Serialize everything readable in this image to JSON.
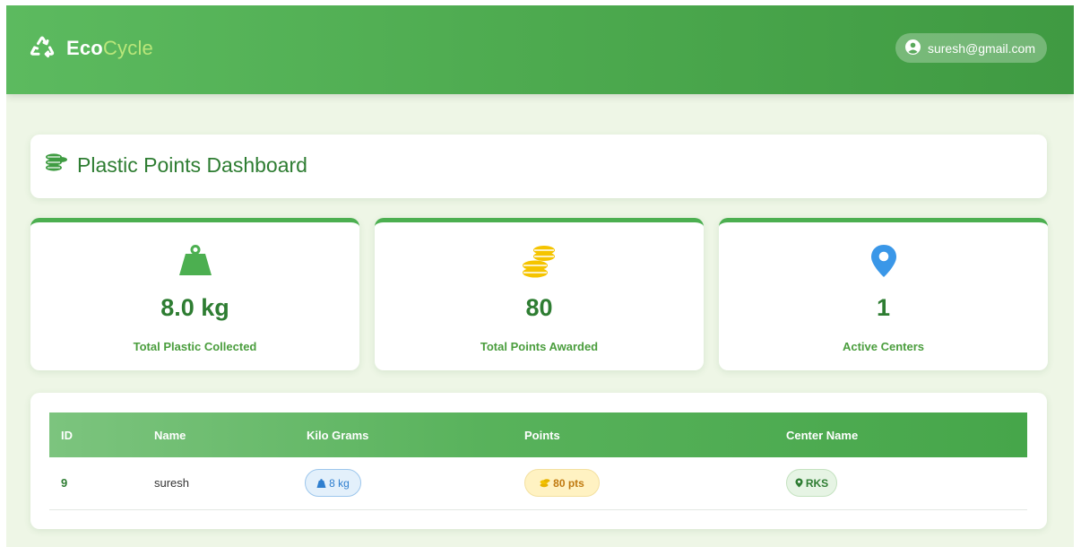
{
  "brand": {
    "name_part1": "Eco",
    "name_part2": "Cycle",
    "icon": "recycle-icon"
  },
  "user": {
    "email": "suresh@gmail.com",
    "icon": "user-circle-icon"
  },
  "dashboard": {
    "title": "Plastic Points Dashboard",
    "icon": "coins-icon"
  },
  "stats": [
    {
      "value": "8.0 kg",
      "label": "Total Plastic Collected",
      "icon": "weight-icon"
    },
    {
      "value": "80",
      "label": "Total Points Awarded",
      "icon": "coins-icon"
    },
    {
      "value": "1",
      "label": "Active Centers",
      "icon": "map-pin-icon"
    }
  ],
  "table": {
    "headers": [
      "ID",
      "Name",
      "Kilo Grams",
      "Points",
      "Center Name"
    ],
    "rows": [
      {
        "id": "9",
        "name": "suresh",
        "kg": "8 kg",
        "points": "80 pts",
        "center": "RKS"
      }
    ]
  },
  "colors": {
    "primary": "#4caf50",
    "primary_dark": "#2e7d32",
    "background": "#eef6e6",
    "kg_badge": "#e3f0fb",
    "points_badge": "#fff2c2",
    "center_badge": "#e6f4e4"
  }
}
